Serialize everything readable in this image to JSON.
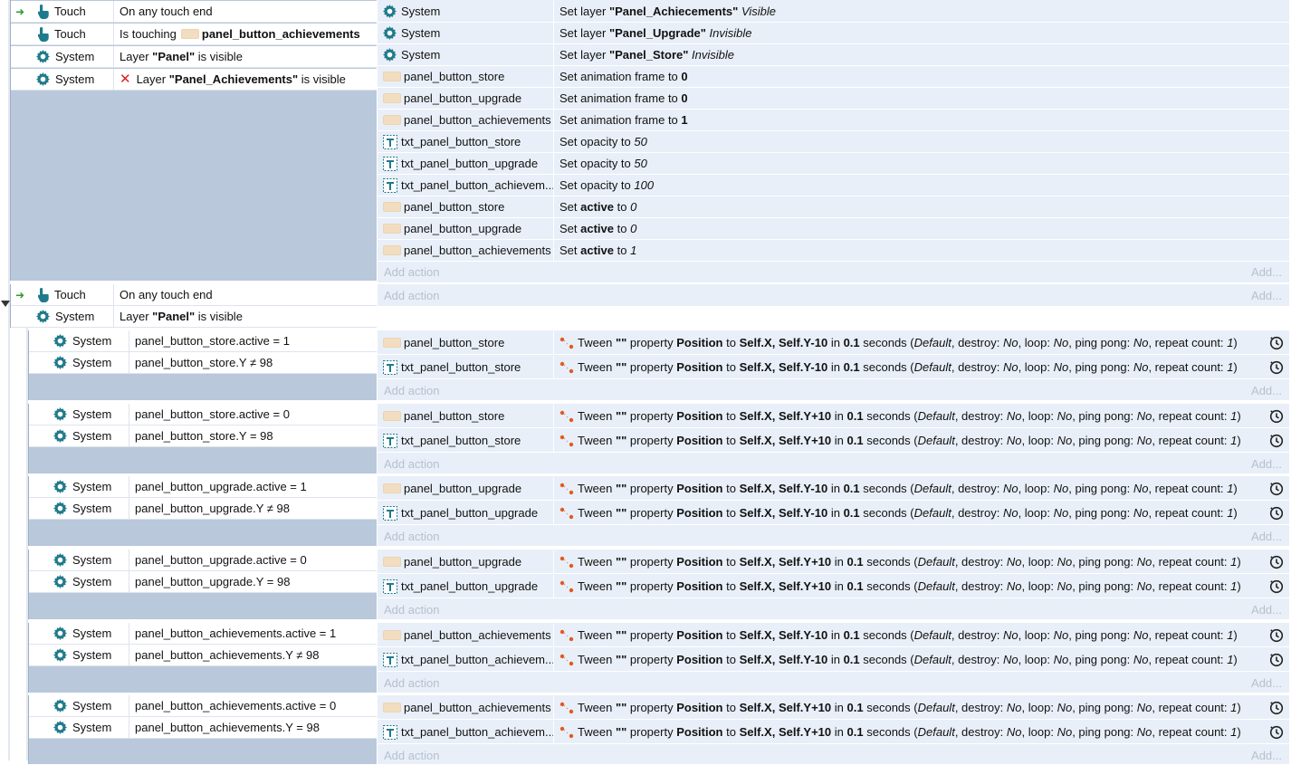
{
  "event1": {
    "conditions": [
      {
        "object": "Touch",
        "icon": "touch-icon",
        "text": "On any touch end"
      },
      {
        "object": "Touch",
        "icon": "touch-icon",
        "text_pre": "Is touching",
        "bold": "panel_button_achievements"
      },
      {
        "object": "System",
        "icon": "gear-icon",
        "text_pre": "Layer",
        "bold": "\"Panel\"",
        "text_post": "is visible"
      },
      {
        "object": "System",
        "icon": "gear-icon",
        "inverted": true,
        "text_pre": "Layer",
        "bold": "\"Panel_Achievements\"",
        "text_post": "is visible"
      }
    ],
    "actions": [
      {
        "object": "System",
        "icon": "gear-icon",
        "pre": "Set layer",
        "bold": "\"Panel_Achiecements\"",
        "ital": "Visible"
      },
      {
        "object": "System",
        "icon": "gear-icon",
        "pre": "Set layer",
        "bold": "\"Panel_Upgrade\"",
        "ital": "Invisible"
      },
      {
        "object": "System",
        "icon": "gear-icon",
        "pre": "Set layer",
        "bold": "\"Panel_Store\"",
        "ital": "Invisible"
      },
      {
        "object": "panel_button_store",
        "icon": "sprite-icon",
        "pre": "Set animation frame to",
        "bold": "0"
      },
      {
        "object": "panel_button_upgrade",
        "icon": "sprite-icon",
        "pre": "Set animation frame to",
        "bold": "0"
      },
      {
        "object": "panel_button_achievements",
        "icon": "sprite-icon",
        "pre": "Set animation frame to",
        "bold": "1"
      },
      {
        "object": "txt_panel_button_store",
        "icon": "text-object-icon",
        "pre": "Set opacity to",
        "ital": "50"
      },
      {
        "object": "txt_panel_button_upgrade",
        "icon": "text-object-icon",
        "pre": "Set opacity to",
        "ital": "50"
      },
      {
        "object": "txt_panel_button_achievem...",
        "icon": "text-object-icon",
        "pre": "Set opacity to",
        "ital": "100"
      },
      {
        "object": "panel_button_store",
        "icon": "sprite-icon",
        "pre": "Set",
        "bold": "active",
        "mid": "to",
        "ital": "0"
      },
      {
        "object": "panel_button_upgrade",
        "icon": "sprite-icon",
        "pre": "Set",
        "bold": "active",
        "mid": "to",
        "ital": "0"
      },
      {
        "object": "panel_button_achievements",
        "icon": "sprite-icon",
        "pre": "Set",
        "bold": "active",
        "mid": "to",
        "ital": "1"
      }
    ]
  },
  "event2": {
    "conditions": [
      {
        "object": "Touch",
        "icon": "touch-icon",
        "text": "On any touch end"
      },
      {
        "object": "System",
        "icon": "gear-icon",
        "text_pre": "Layer",
        "bold": "\"Panel\"",
        "text_post": "is visible"
      }
    ]
  },
  "subevents": [
    {
      "c1": "panel_button_store.active = 1",
      "c2": "panel_button_store.Y ≠ 98",
      "o1": "panel_button_store",
      "o2": "txt_panel_button_store",
      "dir": "-10"
    },
    {
      "c1": "panel_button_store.active = 0",
      "c2": "panel_button_store.Y = 98",
      "o1": "panel_button_store",
      "o2": "txt_panel_button_store",
      "dir": "+10"
    },
    {
      "c1": "panel_button_upgrade.active = 1",
      "c2": "panel_button_upgrade.Y ≠ 98",
      "o1": "panel_button_upgrade",
      "o2": "txt_panel_button_upgrade",
      "dir": "-10"
    },
    {
      "c1": "panel_button_upgrade.active = 0",
      "c2": "panel_button_upgrade.Y = 98",
      "o1": "panel_button_upgrade",
      "o2": "txt_panel_button_upgrade",
      "dir": "+10"
    },
    {
      "c1": "panel_button_achievements.active = 1",
      "c2": "panel_button_achievements.Y ≠ 98",
      "o1": "panel_button_achievements",
      "o2": "txt_panel_button_achievem...",
      "dir": "-10"
    },
    {
      "c1": "panel_button_achievements.active = 0",
      "c2": "panel_button_achievements.Y = 98",
      "o1": "panel_button_achievements",
      "o2": "txt_panel_button_achievem...",
      "dir": "+10"
    }
  ],
  "system_label": "System",
  "tween": {
    "word": "Tween",
    "quotes": "\"\"",
    "property_word": "property",
    "property": "Position",
    "to": "to",
    "x_expr": "Self.X,",
    "y_prefix": "Self.Y",
    "in": "in",
    "duration": "0.1",
    "seconds": "seconds (",
    "ease": "Default",
    "destroy_label": ", destroy:",
    "destroy": "No",
    "loop_label": ", loop:",
    "loop": "No",
    "pingpong_label": ", ping pong:",
    "pingpong": "No",
    "repeat_label": ", repeat count:",
    "repeat": "1",
    "close": ")"
  },
  "add_action": "Add action",
  "add_more": "Add...",
  "colors": {
    "block": "#b9c8da",
    "actions_bg": "#e9eff8",
    "sprite": "#f3ddc0",
    "gear": "#1f7a8c",
    "touch": "#1f7a8c",
    "tween": "#e05a1e",
    "arrow": "#2e9a2e"
  }
}
